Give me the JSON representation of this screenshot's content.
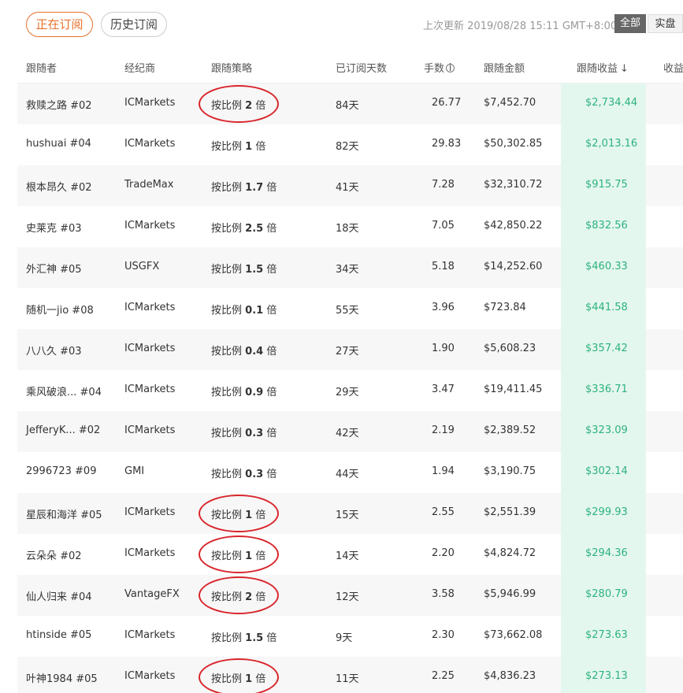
{
  "tabs": {
    "current": "正在订阅",
    "history": "历史订阅"
  },
  "update": {
    "label": "上次更新",
    "time": "2019/08/28 15:11 GMT+8:00"
  },
  "account_filter": {
    "all": "全部",
    "real": "实盘"
  },
  "table": {
    "headers": {
      "follower": "跟随者",
      "broker": "经纪商",
      "strategy": "跟随策略",
      "days": "已订阅天数",
      "lots": "手数",
      "amount": "跟随金额",
      "profit": "跟随收益",
      "rate": "收益"
    },
    "rows": [
      {
        "follower": "救赎之路 #02",
        "broker": "ICMarkets",
        "strategy_prefix": "按比例",
        "ratio": "2",
        "strategy_suffix": "倍",
        "days": "84天",
        "lots": "26.77",
        "amount": "$7,452.70",
        "profit": "$2,734.44"
      },
      {
        "follower": "hushuai #04",
        "broker": "ICMarkets",
        "strategy_prefix": "按比例",
        "ratio": "1",
        "strategy_suffix": "倍",
        "days": "82天",
        "lots": "29.83",
        "amount": "$50,302.85",
        "profit": "$2,013.16"
      },
      {
        "follower": "根本昂久 #02",
        "broker": "TradeMax",
        "strategy_prefix": "按比例",
        "ratio": "1.7",
        "strategy_suffix": "倍",
        "days": "41天",
        "lots": "7.28",
        "amount": "$32,310.72",
        "profit": "$915.75"
      },
      {
        "follower": "史莱克 #03",
        "broker": "ICMarkets",
        "strategy_prefix": "按比例",
        "ratio": "2.5",
        "strategy_suffix": "倍",
        "days": "18天",
        "lots": "7.05",
        "amount": "$42,850.22",
        "profit": "$832.56"
      },
      {
        "follower": "外汇神 #05",
        "broker": "USGFX",
        "strategy_prefix": "按比例",
        "ratio": "1.5",
        "strategy_suffix": "倍",
        "days": "34天",
        "lots": "5.18",
        "amount": "$14,252.60",
        "profit": "$460.33"
      },
      {
        "follower": "随机一jio #08",
        "broker": "ICMarkets",
        "strategy_prefix": "按比例",
        "ratio": "0.1",
        "strategy_suffix": "倍",
        "days": "55天",
        "lots": "3.96",
        "amount": "$723.84",
        "profit": "$441.58"
      },
      {
        "follower": "八八久 #03",
        "broker": "ICMarkets",
        "strategy_prefix": "按比例",
        "ratio": "0.4",
        "strategy_suffix": "倍",
        "days": "27天",
        "lots": "1.90",
        "amount": "$5,608.23",
        "profit": "$357.42"
      },
      {
        "follower": "乘风破浪... #04",
        "broker": "ICMarkets",
        "strategy_prefix": "按比例",
        "ratio": "0.9",
        "strategy_suffix": "倍",
        "days": "29天",
        "lots": "3.47",
        "amount": "$19,411.45",
        "profit": "$336.71"
      },
      {
        "follower": "JefferyK... #02",
        "broker": "ICMarkets",
        "strategy_prefix": "按比例",
        "ratio": "0.3",
        "strategy_suffix": "倍",
        "days": "42天",
        "lots": "2.19",
        "amount": "$2,389.52",
        "profit": "$323.09"
      },
      {
        "follower": "2996723 #09",
        "broker": "GMI",
        "strategy_prefix": "按比例",
        "ratio": "0.3",
        "strategy_suffix": "倍",
        "days": "44天",
        "lots": "1.94",
        "amount": "$3,190.75",
        "profit": "$302.14"
      },
      {
        "follower": "星辰和海洋 #05",
        "broker": "ICMarkets",
        "strategy_prefix": "按比例",
        "ratio": "1",
        "strategy_suffix": "倍",
        "days": "15天",
        "lots": "2.55",
        "amount": "$2,551.39",
        "profit": "$299.93"
      },
      {
        "follower": "云朵朵 #02",
        "broker": "ICMarkets",
        "strategy_prefix": "按比例",
        "ratio": "1",
        "strategy_suffix": "倍",
        "days": "14天",
        "lots": "2.20",
        "amount": "$4,824.72",
        "profit": "$294.36"
      },
      {
        "follower": "仙人归来 #04",
        "broker": "VantageFX",
        "strategy_prefix": "按比例",
        "ratio": "2",
        "strategy_suffix": "倍",
        "days": "12天",
        "lots": "3.58",
        "amount": "$5,946.99",
        "profit": "$280.79"
      },
      {
        "follower": "htinside #05",
        "broker": "ICMarkets",
        "strategy_prefix": "按比例",
        "ratio": "1.5",
        "strategy_suffix": "倍",
        "days": "9天",
        "lots": "2.30",
        "amount": "$73,662.08",
        "profit": "$273.63"
      },
      {
        "follower": "叶神1984 #05",
        "broker": "ICMarkets",
        "strategy_prefix": "按比例",
        "ratio": "1",
        "strategy_suffix": "倍",
        "days": "11天",
        "lots": "2.25",
        "amount": "$4,836.23",
        "profit": "$273.13"
      }
    ]
  },
  "icons": {
    "lots_info": "info-icon",
    "profit_sort": "sort-down-icon"
  },
  "colors": {
    "accent": "#e8702a",
    "profit_text": "#2db27d",
    "profit_bg": "#e4f7ef",
    "annotation": "#d9262c"
  }
}
